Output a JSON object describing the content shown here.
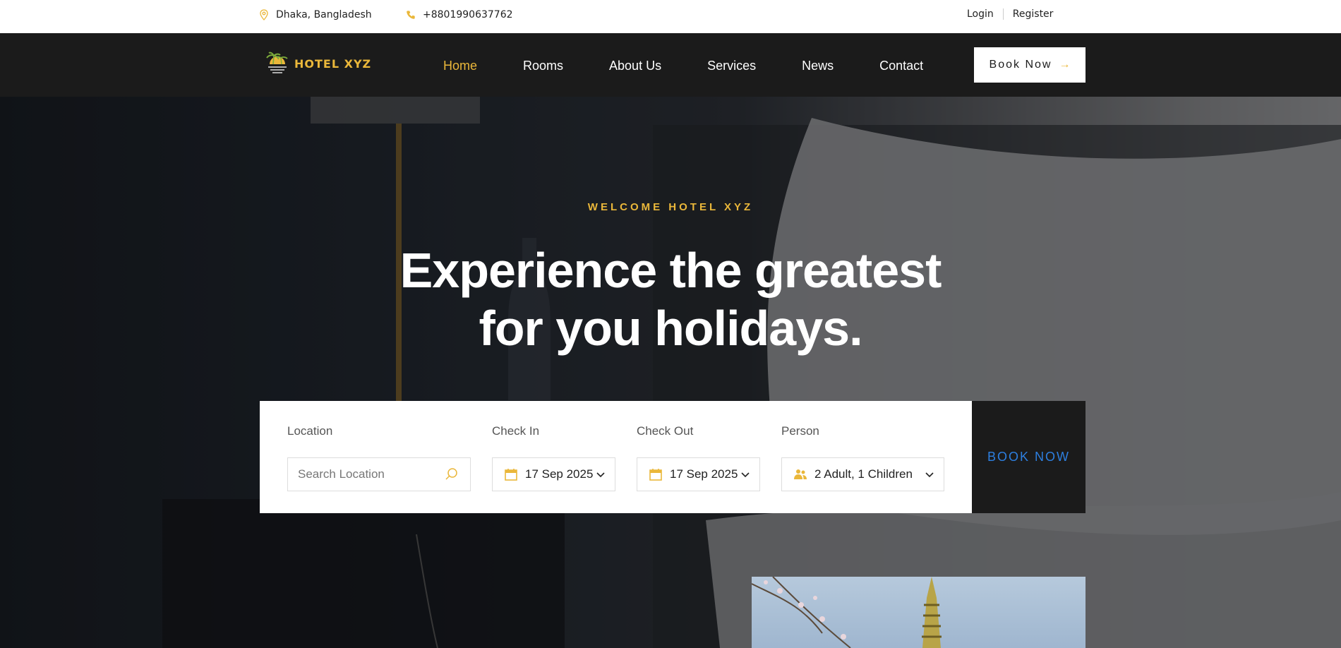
{
  "topbar": {
    "location": "Dhaka, Bangladesh",
    "phone": "+8801990637762",
    "login": "Login",
    "register": "Register"
  },
  "nav": {
    "brand": "HOTEL XYZ",
    "items": [
      {
        "label": "Home",
        "active": true
      },
      {
        "label": "Rooms",
        "active": false
      },
      {
        "label": "About Us",
        "active": false
      },
      {
        "label": "Services",
        "active": false
      },
      {
        "label": "News",
        "active": false
      },
      {
        "label": "Contact",
        "active": false
      }
    ],
    "book_now": "Book Now"
  },
  "hero": {
    "eyebrow": "WELCOME HOTEL XYZ",
    "headline_line1": "Experience the greatest",
    "headline_line2": "for you holidays."
  },
  "booking": {
    "location_label": "Location",
    "location_placeholder": "Search Location",
    "checkin_label": "Check In",
    "checkin_value": "17 Sep 2025",
    "checkout_label": "Check Out",
    "checkout_value": "17 Sep 2025",
    "person_label": "Person",
    "person_value": "2 Adult, 1 Children",
    "book_now": "BOOK NOW"
  },
  "colors": {
    "accent": "#eab73a",
    "dark": "#1b1b1b",
    "link_blue": "#2d7fe0"
  }
}
